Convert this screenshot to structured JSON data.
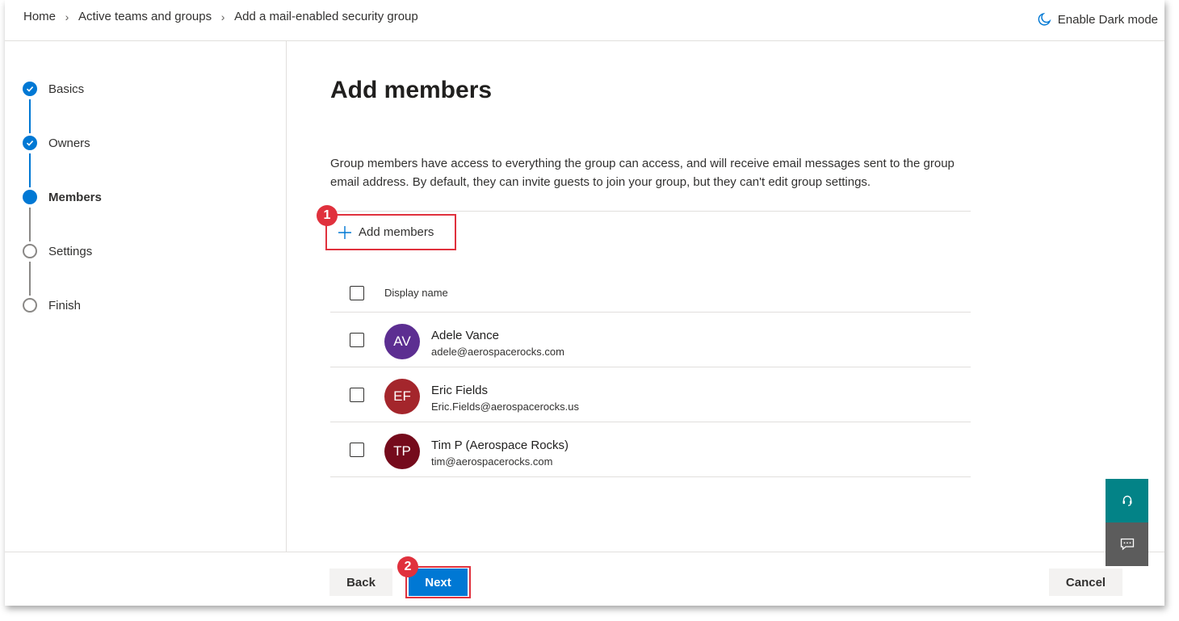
{
  "breadcrumb": {
    "items": [
      "Home",
      "Active teams and groups",
      "Add a mail-enabled security group"
    ]
  },
  "header": {
    "dark_mode_label": "Enable Dark mode"
  },
  "stepper": {
    "steps": [
      {
        "label": "Basics",
        "state": "done"
      },
      {
        "label": "Owners",
        "state": "done"
      },
      {
        "label": "Members",
        "state": "current"
      },
      {
        "label": "Settings",
        "state": "todo"
      },
      {
        "label": "Finish",
        "state": "todo"
      }
    ]
  },
  "main": {
    "title": "Add members",
    "description": "Group members have access to everything the group can access, and will receive email messages sent to the group email address. By default, they can invite guests to join your group, but they can't edit group settings.",
    "add_members_label": "Add members",
    "table": {
      "column_display_name": "Display name",
      "members": [
        {
          "initials": "AV",
          "name": "Adele Vance",
          "email": "adele@aerospacerocks.com",
          "color": "#5c2e91"
        },
        {
          "initials": "EF",
          "name": "Eric Fields",
          "email": "Eric.Fields@aerospacerocks.us",
          "color": "#a4262c"
        },
        {
          "initials": "TP",
          "name": "Tim P (Aerospace Rocks)",
          "email": "tim@aerospacerocks.com",
          "color": "#750b1c"
        }
      ]
    }
  },
  "annotations": {
    "badge_1": "1",
    "badge_2": "2"
  },
  "footer": {
    "back_label": "Back",
    "next_label": "Next",
    "cancel_label": "Cancel"
  },
  "colors": {
    "accent": "#0078d4",
    "highlight": "#e0313d",
    "help_button": "#038387",
    "feedback_button": "#5c5c5c"
  },
  "icons": {
    "dark_mode": "moon-icon",
    "add": "plus-icon",
    "step_done": "checkmark-icon",
    "help": "headset-icon",
    "feedback": "chat-icon"
  }
}
